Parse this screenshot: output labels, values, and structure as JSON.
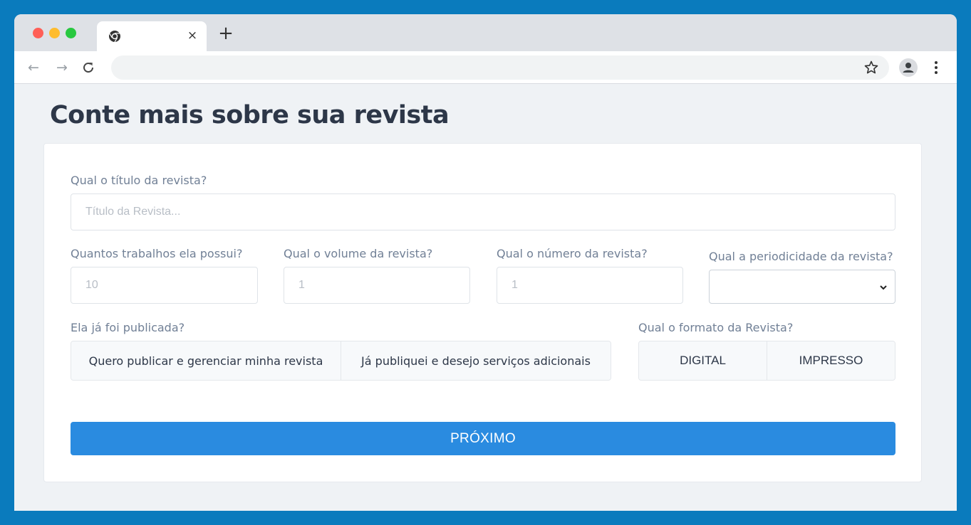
{
  "browser": {
    "traffic_lights": [
      "#ff5f57",
      "#febc2e",
      "#28c840"
    ],
    "tab": {
      "close_glyph": "×",
      "icon": "chrome-icon"
    },
    "new_tab_glyph": "+",
    "nav": {
      "back_glyph": "←",
      "forward_glyph": "→",
      "reload_glyph": "C"
    },
    "address": ""
  },
  "page": {
    "title": "Conte mais sobre sua revista",
    "form": {
      "title_field": {
        "label": "Qual o título da revista?",
        "placeholder": "Título da Revista..."
      },
      "works_field": {
        "label": "Quantos trabalhos ela possui?",
        "placeholder": "10"
      },
      "volume_field": {
        "label": "Qual o volume da revista?",
        "placeholder": "1"
      },
      "number_field": {
        "label": "Qual o número da revista?",
        "placeholder": "1"
      },
      "periodicity_field": {
        "label": "Qual a periodicidade da revista?",
        "value": ""
      },
      "published": {
        "label": "Ela já foi publicada?",
        "options": [
          "Quero publicar e gerenciar minha revista",
          "Já publiquei e desejo serviços adicionais"
        ]
      },
      "format": {
        "label": "Qual o formato da Revista?",
        "options": [
          "DIGITAL",
          "IMPRESSO"
        ]
      },
      "next_label": "PRÓXIMO"
    }
  },
  "colors": {
    "background": "#0a7bbd",
    "page_bg": "#eff2f5",
    "primary_button": "#2a8be0",
    "title_text": "#2d3748",
    "label_text": "#718096"
  }
}
